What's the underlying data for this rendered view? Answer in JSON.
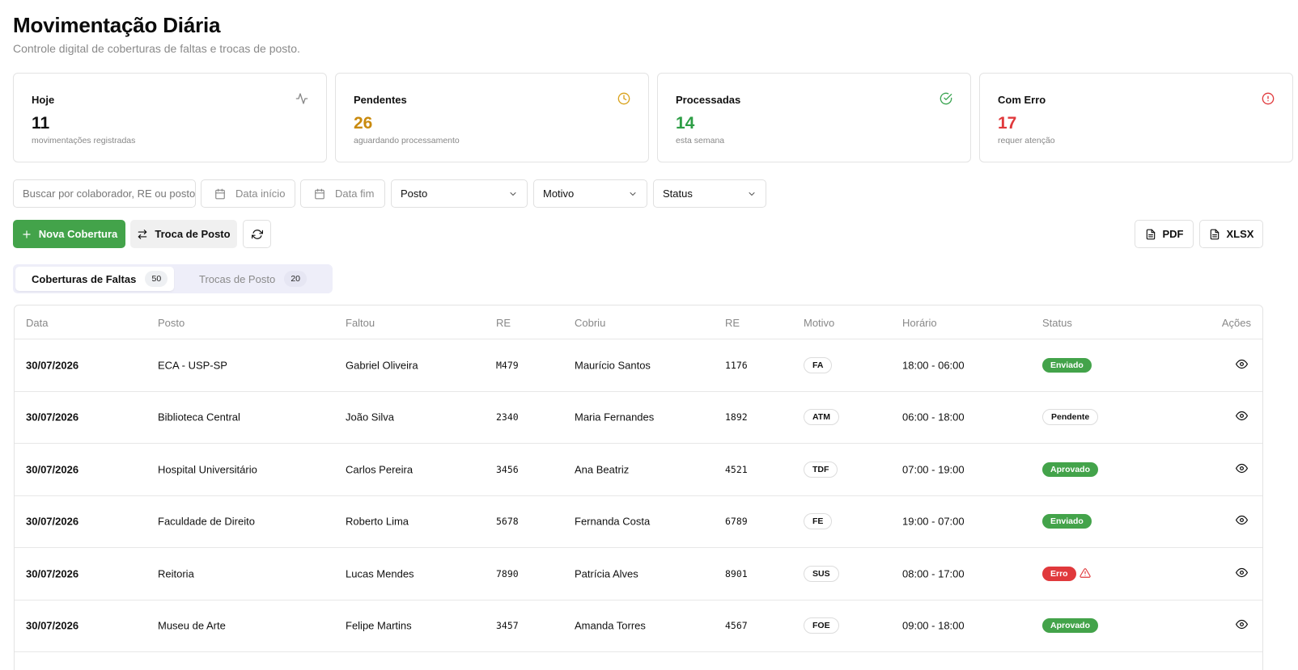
{
  "header": {
    "title": "Movimentação Diária",
    "subtitle": "Controle digital de coberturas de faltas e trocas de posto."
  },
  "cards": [
    {
      "label": "Hoje",
      "value": "11",
      "desc": "movimentações registradas",
      "icon": "activity-icon",
      "color": "#111111"
    },
    {
      "label": "Pendentes",
      "value": "26",
      "desc": "aguardando processamento",
      "icon": "clock-icon",
      "color": "#c98a0e"
    },
    {
      "label": "Processadas",
      "value": "14",
      "desc": "esta semana",
      "icon": "check-circle-icon",
      "color": "#2e9e46"
    },
    {
      "label": "Com Erro",
      "value": "17",
      "desc": "requer atenção",
      "icon": "alert-circle-icon",
      "color": "#e0393c"
    }
  ],
  "filters": {
    "search_placeholder": "Buscar por colaborador, RE ou posto...",
    "date_start": "Data início",
    "date_end": "Data fim",
    "posto": "Posto",
    "motivo": "Motivo",
    "status": "Status"
  },
  "actions": {
    "new_coverage": "Nova Cobertura",
    "swap_post": "Troca de Posto",
    "pdf": "PDF",
    "xlsx": "XLSX"
  },
  "tabs": [
    {
      "label": "Coberturas de Faltas",
      "count": "50",
      "active": true
    },
    {
      "label": "Trocas de Posto",
      "count": "20",
      "active": false
    }
  ],
  "table": {
    "columns": [
      "Data",
      "Posto",
      "Faltou",
      "RE",
      "Cobriu",
      "RE",
      "Motivo",
      "Horário",
      "Status",
      "Ações"
    ],
    "rows": [
      {
        "data": "30/07/2026",
        "posto": "ECA - USP-SP",
        "faltou": "Gabriel Oliveira",
        "re1": "M479",
        "cobriu": "Maurício Santos",
        "re2": "1176",
        "motivo": "FA",
        "horario": "18:00 - 06:00",
        "status": "Enviado",
        "status_type": "green",
        "warning": false
      },
      {
        "data": "30/07/2026",
        "posto": "Biblioteca Central",
        "faltou": "João Silva",
        "re1": "2340",
        "cobriu": "Maria Fernandes",
        "re2": "1892",
        "motivo": "ATM",
        "horario": "06:00 - 18:00",
        "status": "Pendente",
        "status_type": "outline",
        "warning": false
      },
      {
        "data": "30/07/2026",
        "posto": "Hospital Universitário",
        "faltou": "Carlos Pereira",
        "re1": "3456",
        "cobriu": "Ana Beatriz",
        "re2": "4521",
        "motivo": "TDF",
        "horario": "07:00 - 19:00",
        "status": "Aprovado",
        "status_type": "green",
        "warning": false
      },
      {
        "data": "30/07/2026",
        "posto": "Faculdade de Direito",
        "faltou": "Roberto Lima",
        "re1": "5678",
        "cobriu": "Fernanda Costa",
        "re2": "6789",
        "motivo": "FE",
        "horario": "19:00 - 07:00",
        "status": "Enviado",
        "status_type": "green",
        "warning": false
      },
      {
        "data": "30/07/2026",
        "posto": "Reitoria",
        "faltou": "Lucas Mendes",
        "re1": "7890",
        "cobriu": "Patrícia Alves",
        "re2": "8901",
        "motivo": "SUS",
        "horario": "08:00 - 17:00",
        "status": "Erro",
        "status_type": "red",
        "warning": true
      },
      {
        "data": "30/07/2026",
        "posto": "Museu de Arte",
        "faltou": "Felipe Martins",
        "re1": "3457",
        "cobriu": "Amanda Torres",
        "re2": "4567",
        "motivo": "FOE",
        "horario": "09:00 - 18:00",
        "status": "Aprovado",
        "status_type": "green",
        "warning": false
      }
    ]
  }
}
